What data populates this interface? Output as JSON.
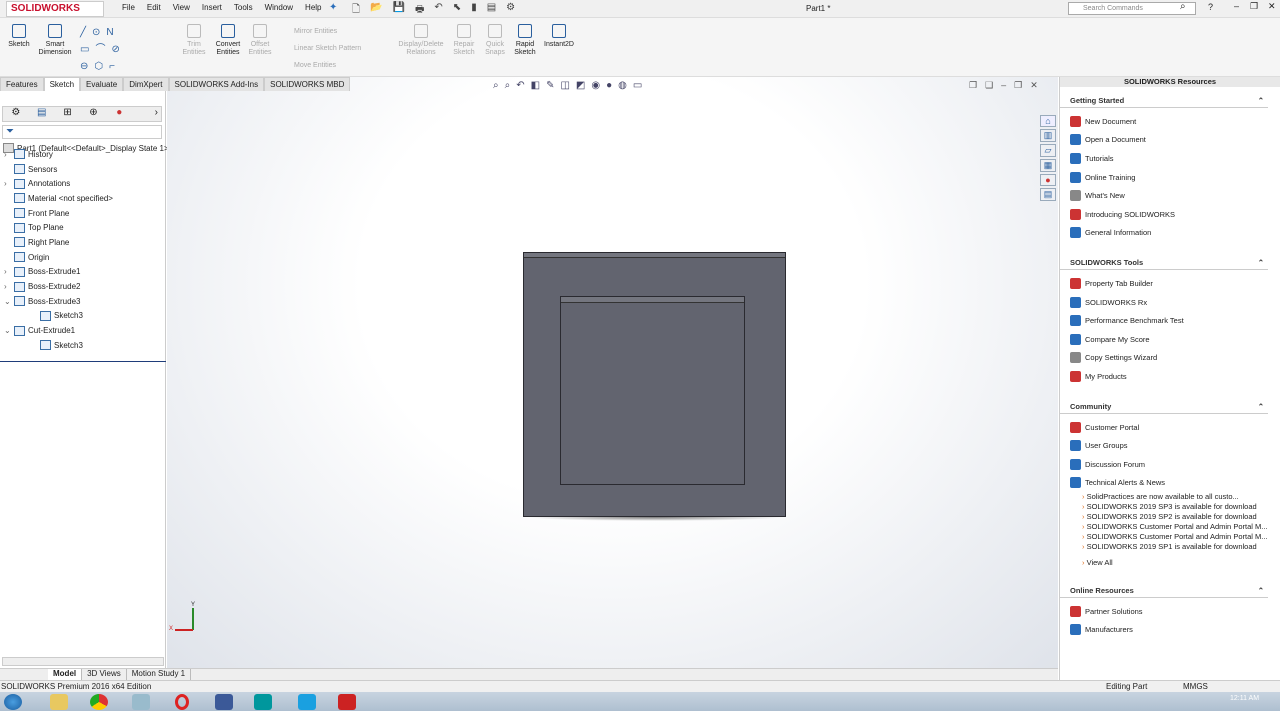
{
  "app": {
    "logo": "SOLIDWORKS",
    "document_title": "Part1 *",
    "search_placeholder": "Search Commands"
  },
  "menu": [
    "File",
    "Edit",
    "View",
    "Insert",
    "Tools",
    "Window",
    "Help"
  ],
  "ribbon": {
    "sketch": "Sketch",
    "smart_dimension": "Smart Dimension",
    "trim": "Trim Entities",
    "convert": "Convert Entities",
    "offset": "Offset Entities",
    "mirror": "Mirror Entities",
    "linear_pattern": "Linear Sketch Pattern",
    "move": "Move Entities",
    "display_delete": "Display/Delete Relations",
    "repair": "Repair Sketch",
    "quick_snaps": "Quick Snaps",
    "rapid_sketch": "Rapid Sketch",
    "instant2d": "Instant2D"
  },
  "tabs": [
    "Features",
    "Sketch",
    "Evaluate",
    "DimXpert",
    "SOLIDWORKS Add-Ins",
    "SOLIDWORKS MBD"
  ],
  "tree": {
    "root": "Part1  (Default<<Default>_Display State 1>",
    "items": [
      {
        "label": "History",
        "indent": 1,
        "arrow": "›"
      },
      {
        "label": "Sensors",
        "indent": 1,
        "arrow": ""
      },
      {
        "label": "Annotations",
        "indent": 1,
        "arrow": "›"
      },
      {
        "label": "Material <not specified>",
        "indent": 1,
        "arrow": ""
      },
      {
        "label": "Front Plane",
        "indent": 1,
        "arrow": ""
      },
      {
        "label": "Top Plane",
        "indent": 1,
        "arrow": ""
      },
      {
        "label": "Right Plane",
        "indent": 1,
        "arrow": ""
      },
      {
        "label": "Origin",
        "indent": 1,
        "arrow": ""
      },
      {
        "label": "Boss-Extrude1",
        "indent": 1,
        "arrow": "›"
      },
      {
        "label": "Boss-Extrude2",
        "indent": 1,
        "arrow": "›"
      },
      {
        "label": "Boss-Extrude3",
        "indent": 1,
        "arrow": "⌄"
      },
      {
        "label": "Sketch3",
        "indent": 2,
        "arrow": ""
      },
      {
        "label": "Cut-Extrude1",
        "indent": 1,
        "arrow": "⌄"
      },
      {
        "label": "Sketch3",
        "indent": 2,
        "arrow": ""
      }
    ]
  },
  "bottom_tabs": [
    "Model",
    "3D Views",
    "Motion Study 1"
  ],
  "triad": {
    "x": "X",
    "y": "Y"
  },
  "resources": {
    "title": "SOLIDWORKS Resources",
    "getting_started": {
      "title": "Getting Started",
      "items": [
        "New Document",
        "Open a Document",
        "Tutorials",
        "Online Training",
        "What's New",
        "Introducing SOLIDWORKS",
        "General Information"
      ]
    },
    "tools": {
      "title": "SOLIDWORKS Tools",
      "items": [
        "Property Tab Builder",
        "SOLIDWORKS Rx",
        "Performance Benchmark Test",
        "Compare My Score",
        "Copy Settings Wizard",
        "My Products"
      ]
    },
    "community": {
      "title": "Community",
      "items": [
        "Customer Portal",
        "User Groups",
        "Discussion Forum",
        "Technical Alerts & News"
      ]
    },
    "news": [
      "SolidPractices are now available to all custo...",
      "SOLIDWORKS 2019 SP3 is available for download",
      "SOLIDWORKS 2019 SP2 is available for download",
      "SOLIDWORKS Customer Portal and Admin Portal M...",
      "SOLIDWORKS Customer Portal and Admin Portal M...",
      "SOLIDWORKS 2019 SP1 is available for download"
    ],
    "view_all": "View All",
    "online": {
      "title": "Online Resources",
      "items": [
        "Partner Solutions",
        "Manufacturers"
      ]
    }
  },
  "status": {
    "edition": "SOLIDWORKS Premium 2016 x64 Edition",
    "mode": "Editing Part",
    "units": "MMGS"
  },
  "clock": {
    "time": "12:11 AM"
  }
}
